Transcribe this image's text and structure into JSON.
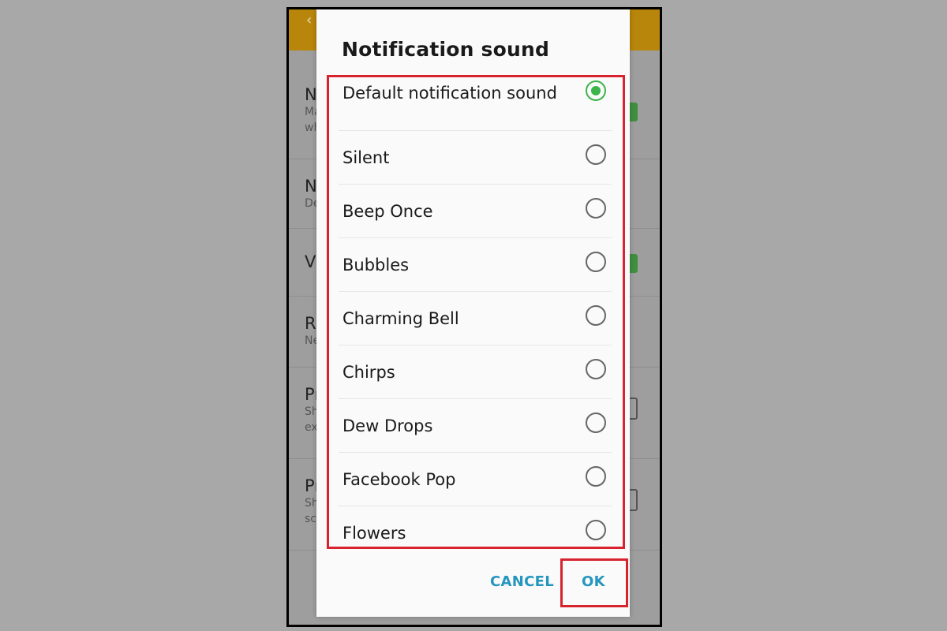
{
  "background_app": {
    "items": [
      {
        "title": "N",
        "subtitle": [
          "Ma",
          "wh"
        ],
        "toggle": "on"
      },
      {
        "title": "N",
        "subtitle": [
          "De"
        ],
        "toggle": "none"
      },
      {
        "title": "V",
        "subtitle": [],
        "toggle": "on"
      },
      {
        "title": "R",
        "subtitle": [
          "Ne"
        ],
        "toggle": "none"
      },
      {
        "title": "Pı",
        "subtitle": [
          "Sh",
          "ex"
        ],
        "toggle": "off"
      },
      {
        "title": "Pı",
        "subtitle": [
          "Sh",
          "sc"
        ],
        "toggle": "off"
      }
    ],
    "back_icon": "‹"
  },
  "dialog": {
    "title": "Notification sound",
    "options": [
      {
        "label": "Default notification sound",
        "selected": true
      },
      {
        "label": "Silent",
        "selected": false
      },
      {
        "label": "Beep Once",
        "selected": false
      },
      {
        "label": "Bubbles",
        "selected": false
      },
      {
        "label": "Charming Bell",
        "selected": false
      },
      {
        "label": "Chirps",
        "selected": false
      },
      {
        "label": "Dew Drops",
        "selected": false
      },
      {
        "label": "Facebook Pop",
        "selected": false
      },
      {
        "label": "Flowers",
        "selected": false
      }
    ],
    "cancel_label": "CANCEL",
    "ok_label": "OK"
  },
  "colors": {
    "accent_selected": "#3bb54a",
    "button_text": "#2596be",
    "highlight_box": "#d8232f",
    "app_bar": "#b8860b"
  }
}
